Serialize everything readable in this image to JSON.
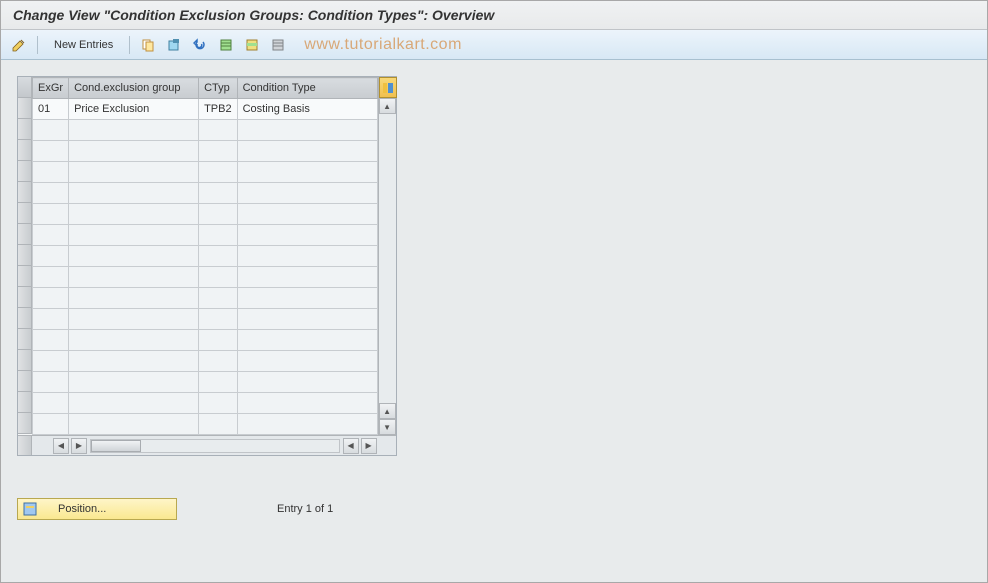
{
  "title": "Change View \"Condition Exclusion Groups: Condition Types\": Overview",
  "toolbar": {
    "new_entries": "New Entries"
  },
  "watermark": "www.tutorialkart.com",
  "table": {
    "headers": {
      "exgr": "ExGr",
      "group": "Cond.exclusion group",
      "ctyp": "CTyp",
      "ctype": "Condition Type"
    },
    "rows": [
      {
        "exgr": "01",
        "group": "Price Exclusion",
        "ctyp": "TPB2",
        "ctype": "Costing Basis"
      }
    ],
    "empty_rows": 15
  },
  "footer": {
    "position_label": "Position...",
    "entry_text": "Entry 1 of 1"
  },
  "icons": {
    "display_change": "display-change",
    "copy": "copy",
    "delete": "delete",
    "undo": "undo",
    "select_all": "select-all",
    "select_block": "select-block",
    "deselect": "deselect"
  }
}
